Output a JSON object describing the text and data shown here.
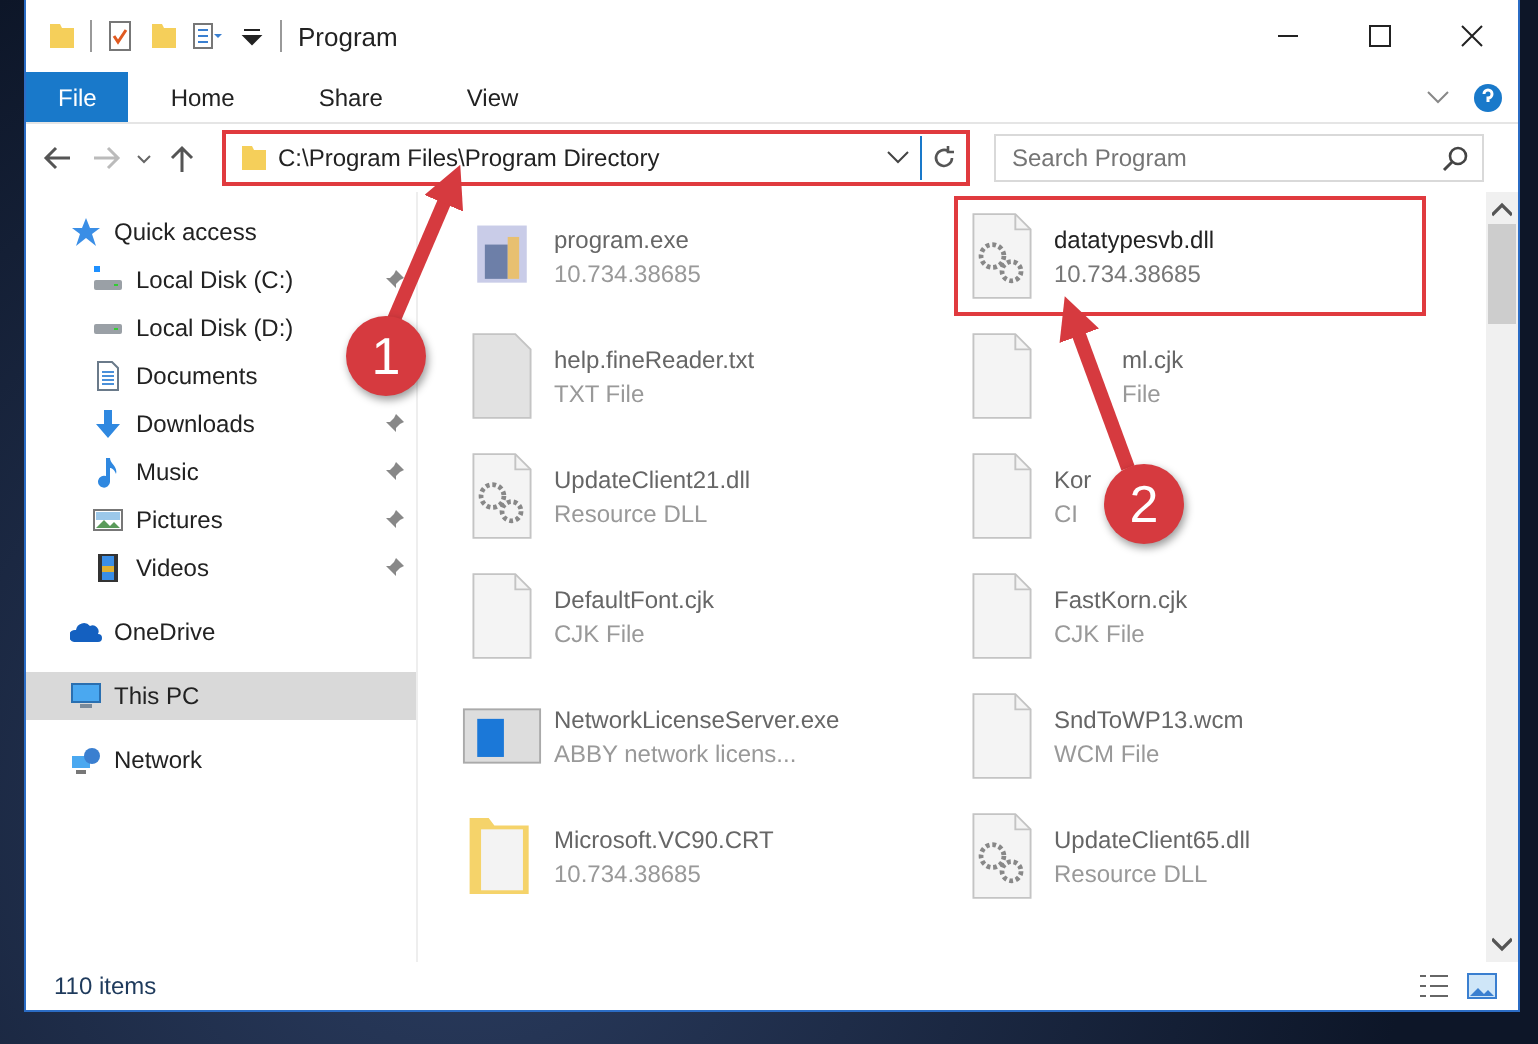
{
  "window": {
    "title": "Program"
  },
  "ribbon_tabs": [
    {
      "label": "File",
      "kind": "file"
    },
    {
      "label": "Home",
      "kind": "tab"
    },
    {
      "label": "Share",
      "kind": "tab"
    },
    {
      "label": "View",
      "kind": "tab"
    }
  ],
  "address_bar": {
    "path": "C:\\Program Files\\Program Directory",
    "highlighted": true
  },
  "search": {
    "placeholder": "Search Program"
  },
  "sidebar": {
    "items": [
      {
        "label": "Quick access",
        "kind": "quick",
        "selected": false,
        "children": [
          {
            "label": "Local Disk (C:)",
            "kind": "sysdrive",
            "pinned": true,
            "selected": false
          },
          {
            "label": "Local Disk (D:)",
            "kind": "drive",
            "pinned": false,
            "selected": false
          },
          {
            "label": "Documents",
            "kind": "documents",
            "pinned": false,
            "selected": false
          },
          {
            "label": "Downloads",
            "kind": "downloads",
            "pinned": true,
            "selected": false
          },
          {
            "label": "Music",
            "kind": "music",
            "pinned": true,
            "selected": false
          },
          {
            "label": "Pictures",
            "kind": "pictures",
            "pinned": true,
            "selected": false
          },
          {
            "label": "Videos",
            "kind": "videos",
            "pinned": true,
            "selected": false
          }
        ]
      },
      {
        "label": "OneDrive",
        "kind": "cloud",
        "selected": false
      },
      {
        "label": "This PC",
        "kind": "pc",
        "selected": true
      },
      {
        "label": "Network",
        "kind": "network",
        "selected": false
      }
    ]
  },
  "files": [
    {
      "name": "program.exe",
      "detail": "10.734.38685",
      "kind": "exe",
      "blurred": true,
      "highlighted": false
    },
    {
      "name": "datatypesvb.dll",
      "detail": "10.734.38685",
      "kind": "dll",
      "blurred": false,
      "highlighted": true
    },
    {
      "name": "help.fineReader.txt",
      "detail": "TXT File",
      "kind": "text",
      "blurred": true,
      "highlighted": false
    },
    {
      "name": "ml.cjk",
      "detail": "File",
      "kind": "blank",
      "blurred": true,
      "highlighted": false
    },
    {
      "name": "UpdateClient21.dll",
      "detail": "Resource DLL",
      "kind": "dll",
      "blurred": true,
      "highlighted": false
    },
    {
      "name": "Kor",
      "detail": "CI",
      "kind": "blank",
      "blurred": true,
      "highlighted": false
    },
    {
      "name": "DefaultFont.cjk",
      "detail": "CJK File",
      "kind": "blank",
      "blurred": true,
      "highlighted": false
    },
    {
      "name": "FastKorn.cjk",
      "detail": "CJK File",
      "kind": "blank",
      "blurred": true,
      "highlighted": false
    },
    {
      "name": "NetworkLicenseServer.exe",
      "detail": "ABBY network licens...",
      "kind": "app",
      "blurred": true,
      "highlighted": false
    },
    {
      "name": "SndToWP13.wcm",
      "detail": "WCM File",
      "kind": "blank",
      "blurred": true,
      "highlighted": false
    },
    {
      "name": "Microsoft.VC90.CRT",
      "detail": "10.734.38685",
      "kind": "folder",
      "blurred": true,
      "highlighted": false
    },
    {
      "name": "UpdateClient65.dll",
      "detail": "Resource DLL",
      "kind": "dll",
      "blurred": true,
      "highlighted": false
    }
  ],
  "annotations": [
    {
      "number": "1"
    },
    {
      "number": "2"
    }
  ],
  "status_bar": {
    "item_count": "110 items"
  }
}
